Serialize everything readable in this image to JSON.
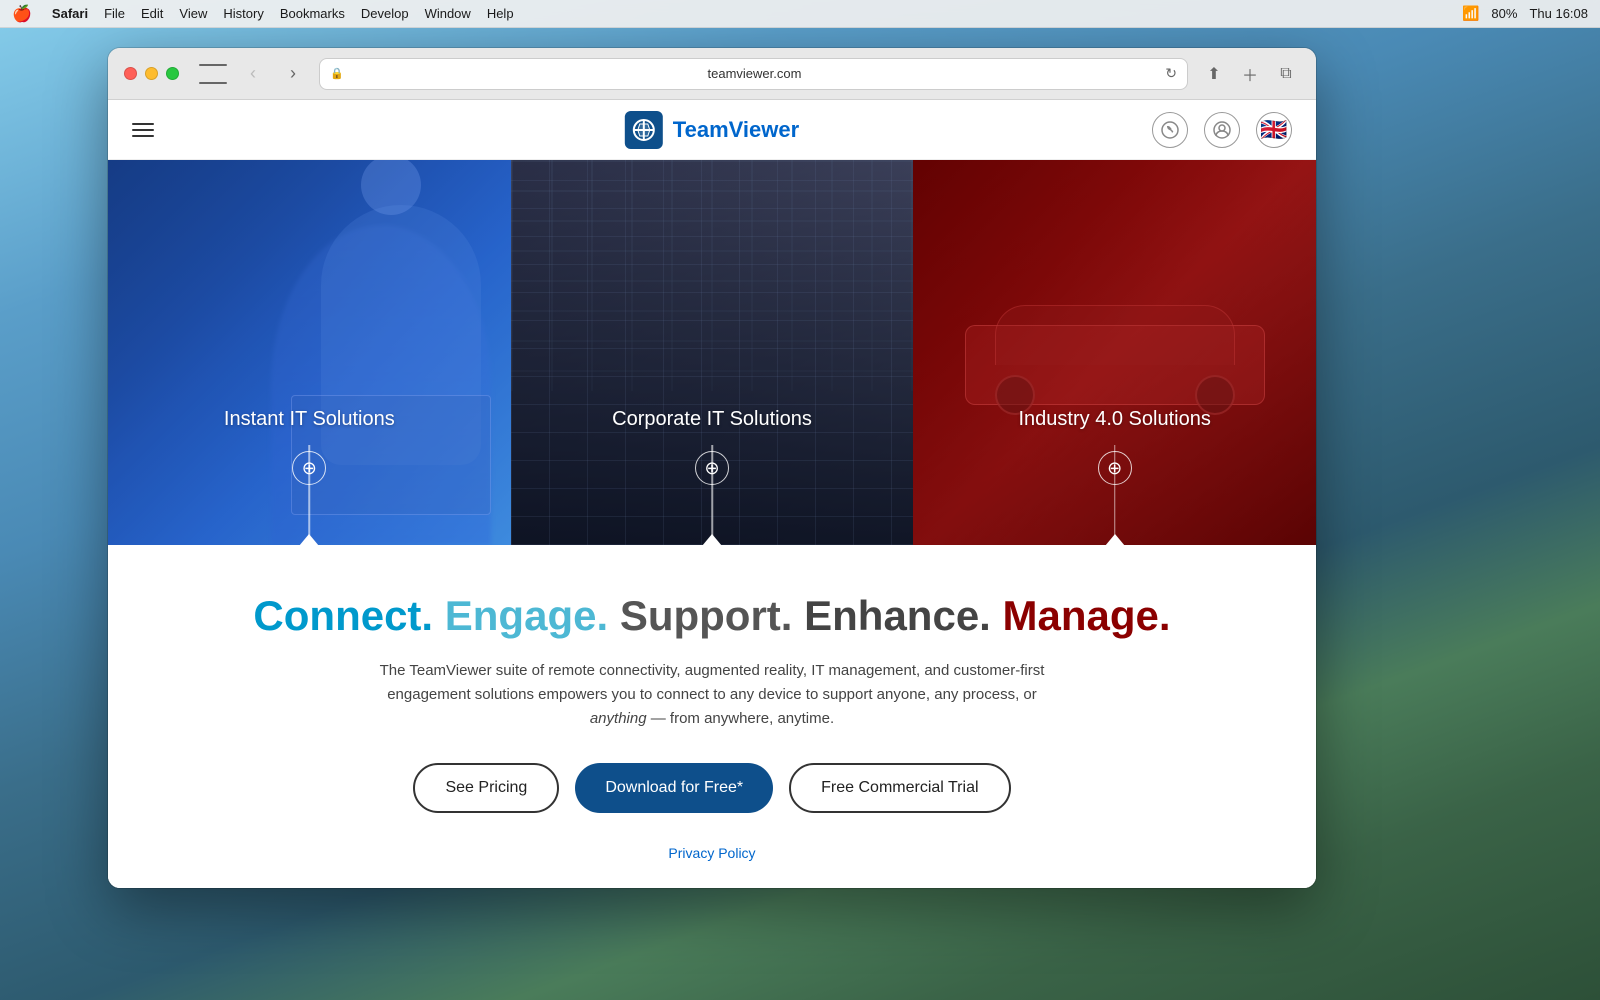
{
  "desktop": {
    "time": "Thu 16:08"
  },
  "menubar": {
    "apple": "🍎",
    "items": [
      "Safari",
      "File",
      "Edit",
      "View",
      "History",
      "Bookmarks",
      "Develop",
      "Window",
      "Help"
    ],
    "battery": "80%"
  },
  "browser": {
    "url": "teamviewer.com",
    "lock_icon": "🔒"
  },
  "site": {
    "logo_text_part1": "Team",
    "logo_text_part2": "Viewer",
    "cards": [
      {
        "title": "Instant IT Solutions",
        "color": "blue"
      },
      {
        "title": "Corporate IT Solutions",
        "color": "dark"
      },
      {
        "title": "Industry 4.0 Solutions",
        "color": "red"
      }
    ],
    "tagline": {
      "connect": "Connect.",
      "engage": "Engage.",
      "support": "Support.",
      "enhance": "Enhance.",
      "manage": "Manage."
    },
    "description": "The TeamViewer suite of remote connectivity, augmented reality, IT management, and customer-first engagement solutions empowers you to connect to any device to support anyone, any process, or",
    "description_italic": "anything",
    "description_end": "— from anywhere, anytime.",
    "buttons": {
      "see_pricing": "See Pricing",
      "download": "Download for Free*",
      "free_trial": "Free Commercial Trial"
    },
    "privacy_link": "Privacy Policy"
  }
}
